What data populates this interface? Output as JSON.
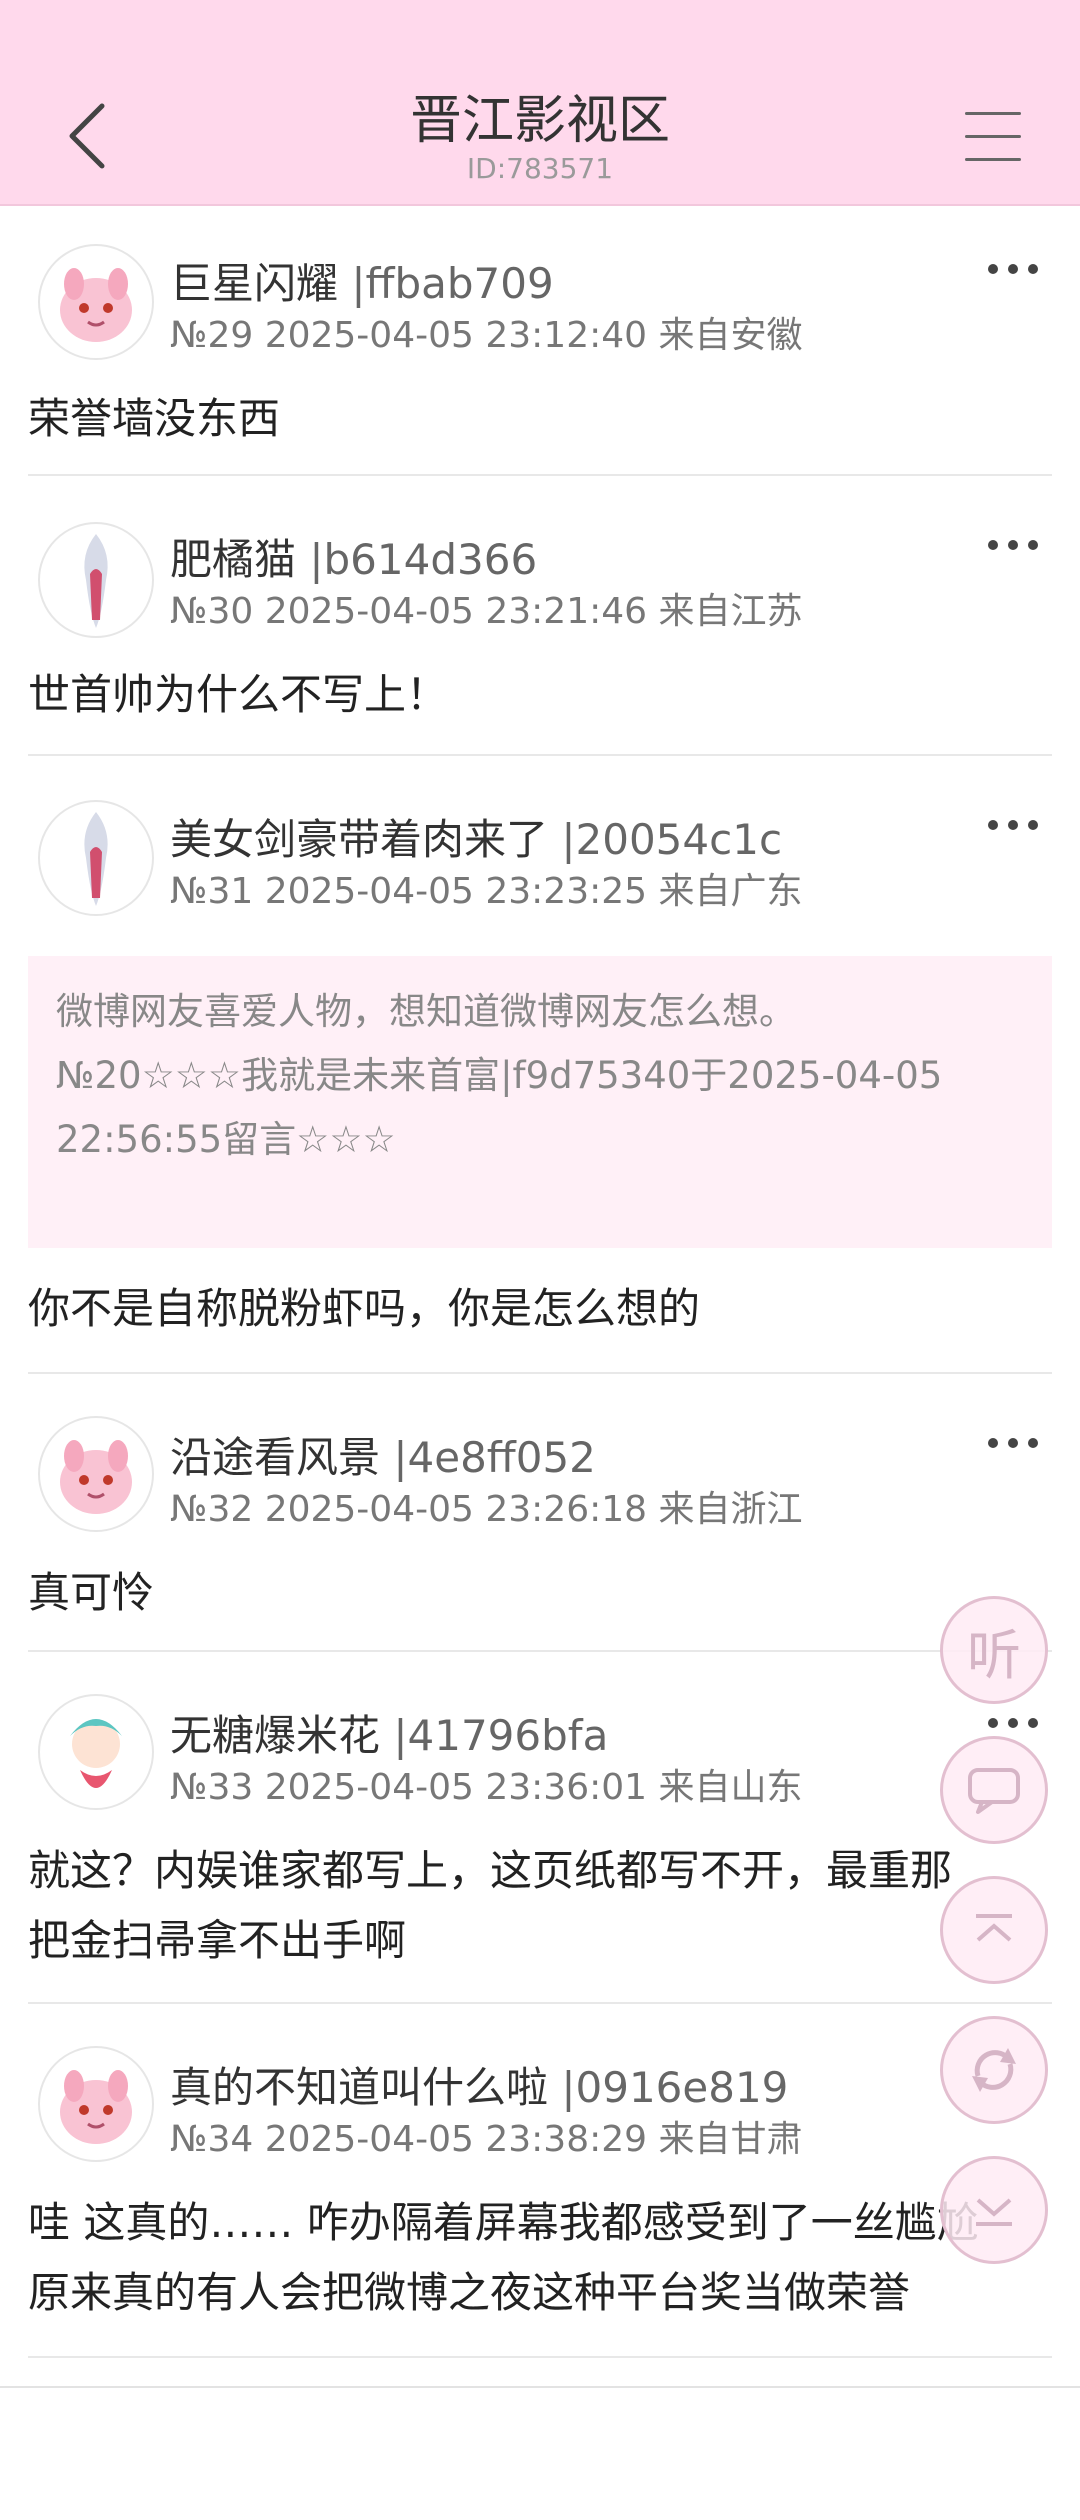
{
  "header": {
    "title": "晋江影视区",
    "id_label": "ID:783571"
  },
  "posts": [
    {
      "username": "巨星闪耀",
      "uid": " |ffbab709",
      "meta": "№29 2025-04-05 23:12:40 来自安徽",
      "lines": [
        "荣誉墙没东西"
      ]
    },
    {
      "username": "肥橘猫",
      "uid": " |b614d366",
      "meta": "№30 2025-04-05 23:21:46 来自江苏",
      "lines": [
        "世首帅为什么不写上！"
      ]
    },
    {
      "username": "美女剑豪带着肉来了",
      "uid": " |20054c1c",
      "meta": "№31 2025-04-05 23:23:25 来自广东",
      "quote": [
        "微博网友喜爱人物，想知道微博网友怎么想。",
        "№20☆☆☆我就是未来首富|f9d75340于2025-04-05",
        "22:56:55留言☆☆☆"
      ],
      "lines": [
        "你不是自称脱粉虾吗，你是怎么想的"
      ]
    },
    {
      "username": "沿途看风景",
      "uid": " |4e8ff052",
      "meta": "№32 2025-04-05 23:26:18 来自浙江",
      "lines": [
        "真可怜"
      ]
    },
    {
      "username": "无糖爆米花",
      "uid": " |41796bfa",
      "meta": "№33 2025-04-05 23:36:01 来自山东",
      "lines": [
        "就这？内娱谁家都写上，这页纸都写不开，最重那",
        "把金扫帚拿不出手啊"
      ]
    },
    {
      "username": "真的不知道叫什么啦",
      "uid": " |0916e819",
      "meta": "№34 2025-04-05 23:38:29 来自甘肃",
      "lines": [
        "哇 这真的…… 咋办隔着屏幕我都感受到了一丝尴尬",
        "原来真的有人会把微博之夜这种平台奖当做荣誉"
      ]
    }
  ],
  "fabs": {
    "listen_label": "听"
  },
  "colors": {
    "header_bg": "#ffd9ec",
    "quote_bg": "#fff0f7",
    "fab_border": "#e3bfd0"
  }
}
